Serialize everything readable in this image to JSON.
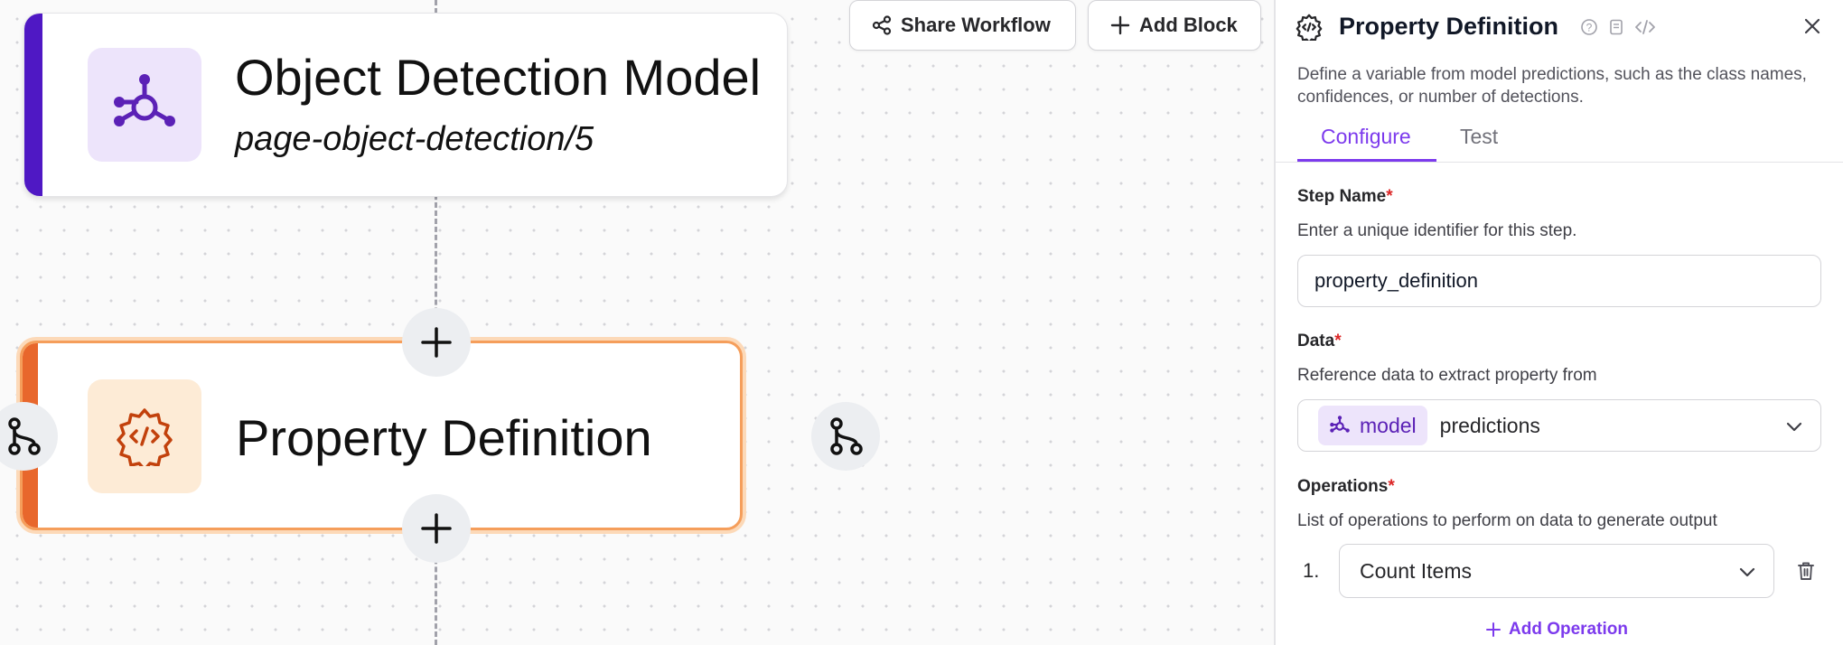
{
  "toolbar": {
    "share_label": "Share Workflow",
    "add_block_label": "Add Block"
  },
  "canvas": {
    "model_node": {
      "title": "Object Detection Model",
      "subtitle": "page-object-detection/5",
      "icon": "model-network-icon",
      "accent_color": "#4f18c4"
    },
    "property_node": {
      "title": "Property Definition",
      "icon": "code-gear-icon",
      "accent_color": "#e8672c",
      "selected": true
    }
  },
  "panel": {
    "title": "Property Definition",
    "description": "Define a variable from model predictions, such as the class names, confidences, or number of detections.",
    "tabs": [
      {
        "label": "Configure",
        "active": true
      },
      {
        "label": "Test",
        "active": false
      }
    ],
    "step_name": {
      "label": "Step Name",
      "required_mark": "*",
      "help": "Enter a unique identifier for this step.",
      "value": "property_definition"
    },
    "data": {
      "label": "Data",
      "required_mark": "*",
      "help": "Reference data to extract property from",
      "chip_label": "model",
      "value": "predictions"
    },
    "operations": {
      "label": "Operations",
      "required_mark": "*",
      "help": "List of operations to perform on data to generate output",
      "items": [
        {
          "number": "1.",
          "value": "Count Items"
        }
      ],
      "add_label": "Add Operation"
    }
  },
  "colors": {
    "brand_purple": "#7c3aed",
    "required_red": "#dc2626"
  }
}
